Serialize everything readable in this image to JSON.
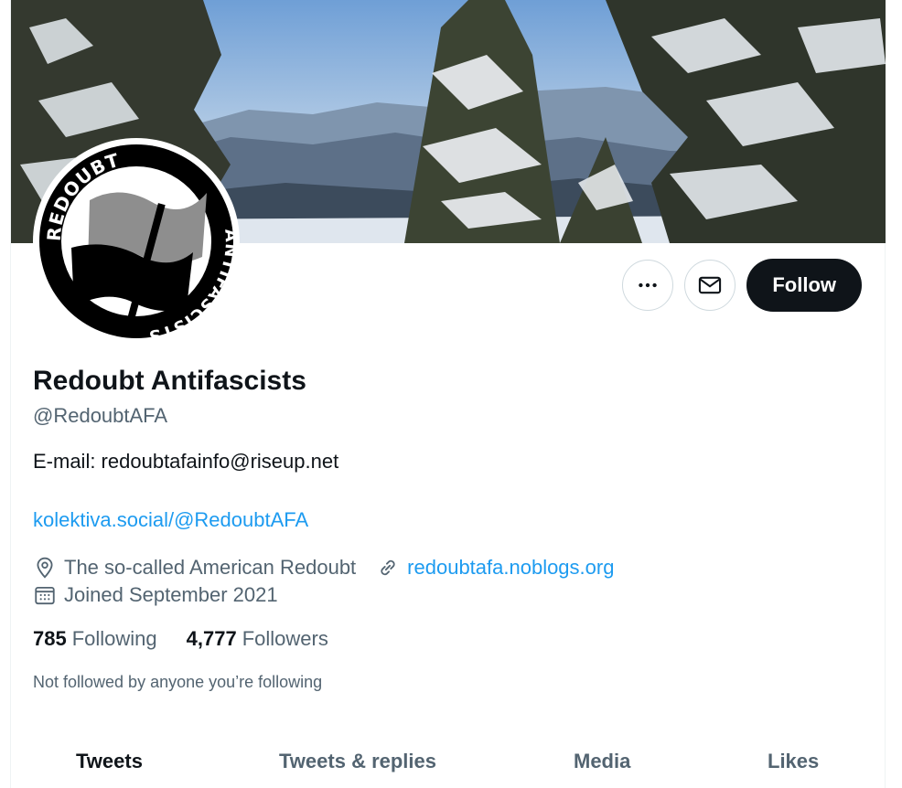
{
  "profile": {
    "name": "Redoubt Antifascists",
    "handle": "@RedoubtAFA",
    "bio": "E-mail: redoubtafainfo@riseup.net",
    "bio_link": "kolektiva.social/@RedoubtAFA",
    "location": "The so-called American Redoubt",
    "website": "redoubtafa.noblogs.org",
    "joined": "Joined September 2021"
  },
  "avatar": {
    "top_text": "REDOUBT",
    "bottom_text": "ANTIFASCISTS"
  },
  "stats": {
    "following_count": "785",
    "following_label": "Following",
    "followers_count": "4,777",
    "followers_label": "Followers"
  },
  "social_context": "Not followed by anyone you’re following",
  "buttons": {
    "follow": "Follow"
  },
  "icons": {
    "more": "more-icon",
    "message": "mail-icon",
    "location": "location-pin-icon",
    "link": "link-icon",
    "calendar": "calendar-icon"
  },
  "tabs": [
    "Tweets",
    "Tweets & replies",
    "Media",
    "Likes"
  ],
  "colors": {
    "accent": "#1d9bf0",
    "text": "#0f1419",
    "secondary": "#536471",
    "follow_bg": "#0f1419"
  }
}
